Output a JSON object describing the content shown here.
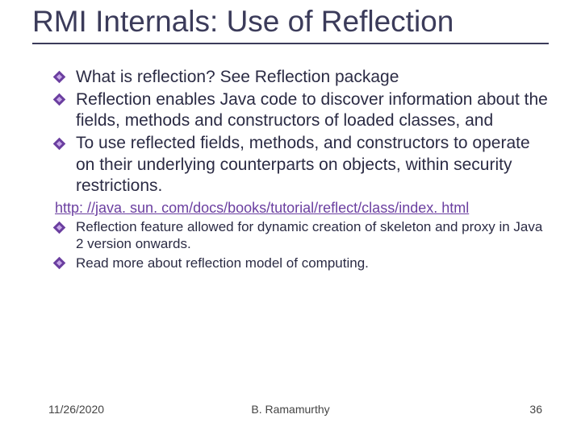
{
  "title": "RMI Internals: Use of Reflection",
  "bullets_large": [
    "What is reflection? See Reflection package",
    "Reflection enables Java code to discover information about the fields, methods and constructors of loaded classes, and",
    "To use reflected fields, methods, and constructors to operate on their underlying counterparts on objects, within security restrictions."
  ],
  "link_text": "http: //java. sun. com/docs/books/tutorial/reflect/class/index. html",
  "bullets_small": [
    "Reflection feature allowed for dynamic creation of skeleton and proxy in Java 2 version onwards.",
    "Read more about reflection model of computing."
  ],
  "footer": {
    "date": "11/26/2020",
    "author": "B. Ramamurthy",
    "page": "36"
  }
}
